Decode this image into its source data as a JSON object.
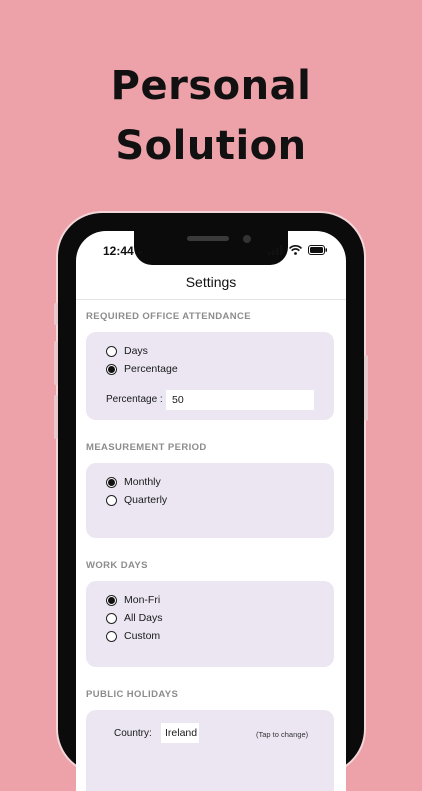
{
  "headline": {
    "line1": "Personal",
    "line2": "Solution"
  },
  "status_bar": {
    "time": "12:44"
  },
  "nav": {
    "title": "Settings"
  },
  "sections": {
    "attendance": {
      "header": "REQUIRED OFFICE ATTENDANCE",
      "options": [
        "Days",
        "Percentage"
      ],
      "selected": "Percentage",
      "percentage_label": "Percentage :",
      "percentage_value": "50"
    },
    "measurement": {
      "header": "MEASUREMENT PERIOD",
      "options": [
        "Monthly",
        "Quarterly"
      ],
      "selected": "Monthly"
    },
    "work_days": {
      "header": "WORK DAYS",
      "options": [
        "Mon-Fri",
        "All Days",
        "Custom"
      ],
      "selected": "Mon-Fri"
    },
    "holidays": {
      "header": "PUBLIC HOLIDAYS",
      "country_label": "Country:",
      "country_value": "Ireland",
      "hint": "(Tap to change)"
    }
  },
  "colors": {
    "background": "#eda2a9",
    "card": "#ebe6f2",
    "section_header": "#8c8c8c"
  }
}
